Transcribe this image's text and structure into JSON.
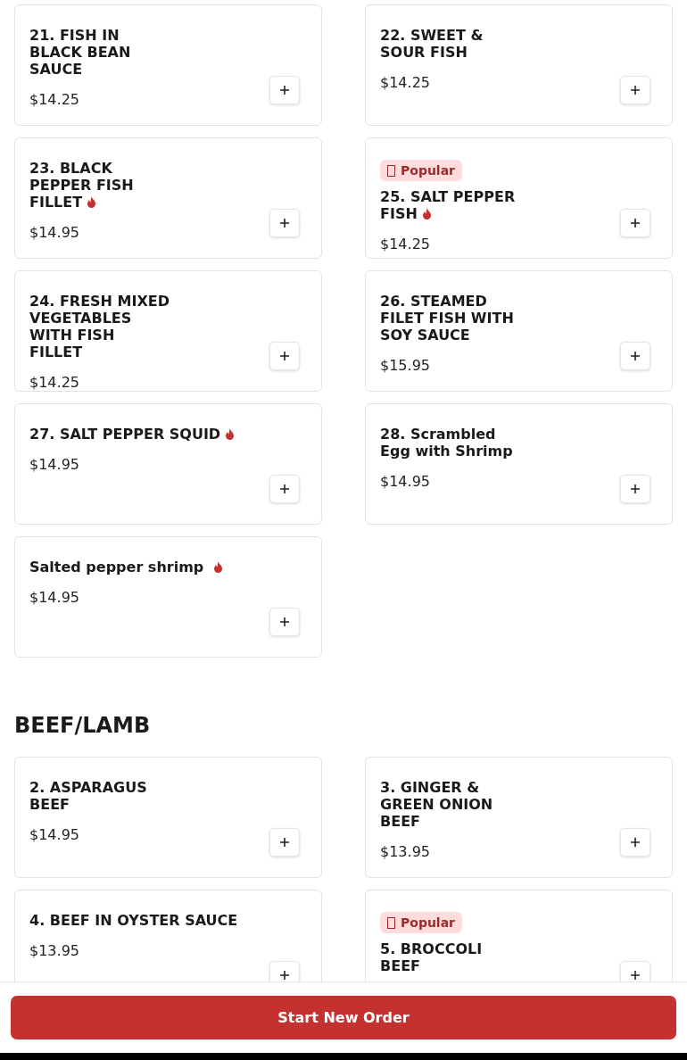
{
  "sections": [
    {
      "items": [
        {
          "name": "21. FISH IN\nBLACK BEAN\nSAUCE",
          "price": "$14.25",
          "spicy": false,
          "popular": false
        },
        {
          "name": "22. SWEET &\nSOUR FISH",
          "price": "$14.25",
          "spicy": false,
          "popular": false
        },
        {
          "name": "23. BLACK\nPEPPER FISH\nFILLET",
          "price": "$14.95",
          "spicy": true,
          "popular": false
        },
        {
          "name": "25. SALT PEPPER\nFISH",
          "price": "$14.25",
          "spicy": true,
          "popular": true,
          "badge": "Popular"
        },
        {
          "name": "24. FRESH MIXED\nVEGETABLES\nWITH FISH\nFILLET",
          "price": "$14.25",
          "spicy": false,
          "popular": false
        },
        {
          "name": "26. STEAMED\nFILET FISH WITH\nSOY SAUCE",
          "price": "$15.95",
          "spicy": false,
          "popular": false
        },
        {
          "name": "27. SALT PEPPER SQUID",
          "price": "$14.95",
          "spicy": true,
          "popular": false
        },
        {
          "name": "28. Scrambled\nEgg with Shrimp",
          "price": "$14.95",
          "spicy": false,
          "popular": false
        },
        {
          "name": "Salted pepper shrimp ",
          "price": "$14.95",
          "spicy": true,
          "popular": false
        }
      ]
    },
    {
      "title": "BEEF/LAMB",
      "items": [
        {
          "name": "2. ASPARAGUS\nBEEF",
          "price": "$14.95",
          "spicy": false,
          "popular": false
        },
        {
          "name": "3. GINGER &\nGREEN ONION\nBEEF",
          "price": "$13.95",
          "spicy": false,
          "popular": false
        },
        {
          "name": "4. BEEF IN OYSTER SAUCE",
          "price": "$13.95",
          "spicy": false,
          "popular": false
        },
        {
          "name": "5. BROCCOLI\nBEEF",
          "spicy": false,
          "popular": true,
          "badge": "Popular"
        }
      ]
    }
  ],
  "footer": {
    "button": "Start New Order"
  }
}
